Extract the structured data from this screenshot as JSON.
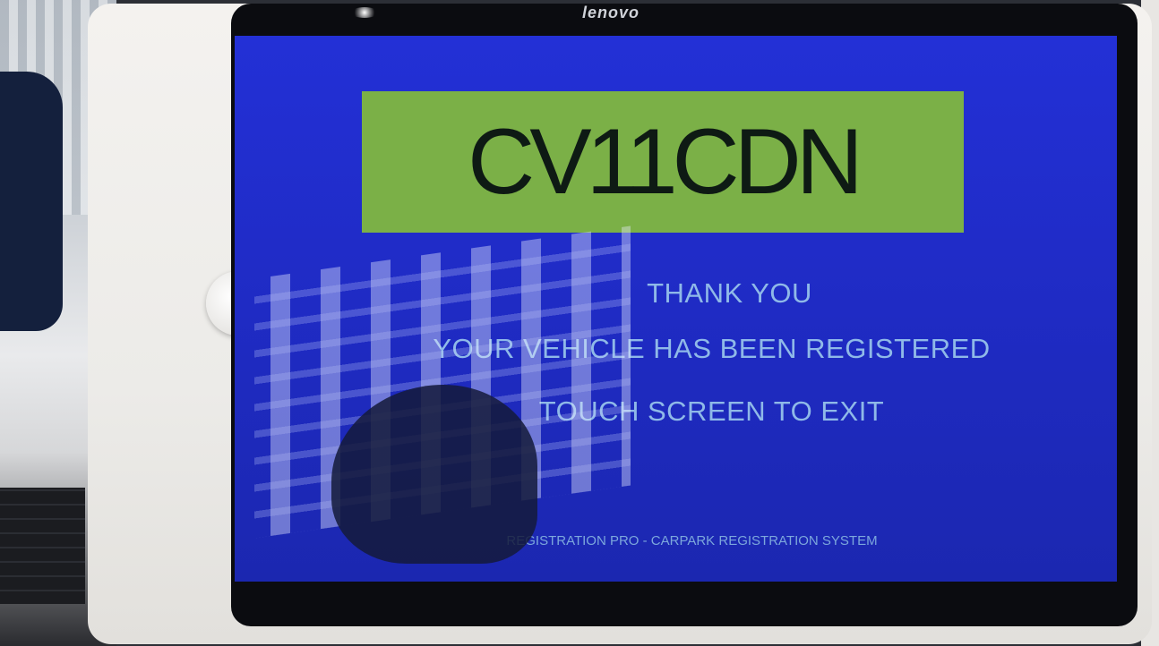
{
  "device": {
    "brand": "lenovo"
  },
  "screen": {
    "plate": "CV11CDN",
    "messages": {
      "thanks": "THANK YOU",
      "registered": "YOUR VEHICLE HAS BEEN REGISTERED",
      "touch_exit": "TOUCH SCREEN TO EXIT"
    },
    "footer": "REGISTRATION PRO - CARPARK REGISTRATION SYSTEM",
    "colors": {
      "background": "#2330d6",
      "plate_box": "#7bb047",
      "text": "#8fb9e8"
    }
  }
}
